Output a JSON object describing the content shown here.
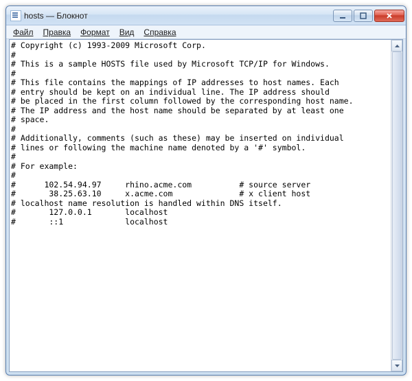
{
  "window": {
    "title": "hosts — Блокнот"
  },
  "menu": {
    "file": "Файл",
    "edit": "Правка",
    "format": "Формат",
    "view": "Вид",
    "help": "Справка"
  },
  "content": "# Copyright (c) 1993-2009 Microsoft Corp.\n#\n# This is a sample HOSTS file used by Microsoft TCP/IP for Windows.\n#\n# This file contains the mappings of IP addresses to host names. Each\n# entry should be kept on an individual line. The IP address should\n# be placed in the first column followed by the corresponding host name.\n# The IP address and the host name should be separated by at least one\n# space.\n#\n# Additionally, comments (such as these) may be inserted on individual\n# lines or following the machine name denoted by a '#' symbol.\n#\n# For example:\n#\n#      102.54.94.97     rhino.acme.com          # source server\n#       38.25.63.10     x.acme.com              # x client host\n# localhost name resolution is handled within DNS itself.\n#       127.0.0.1       localhost\n#       ::1             localhost"
}
